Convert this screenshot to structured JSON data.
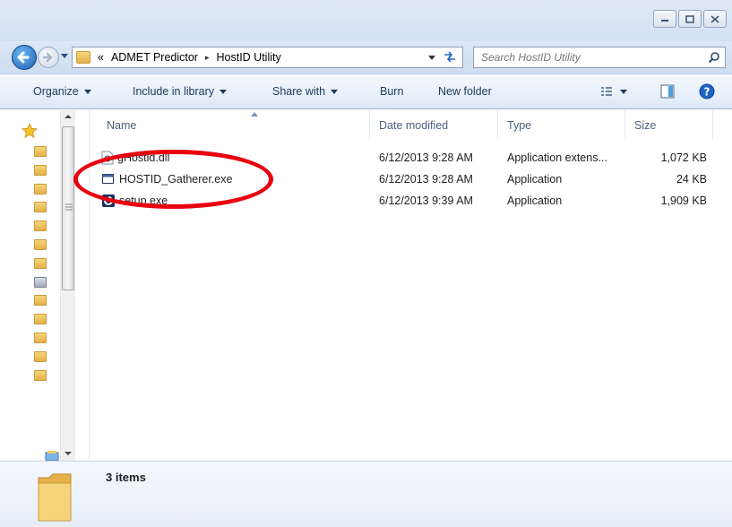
{
  "window": {
    "controls": [
      "minimize",
      "maximize",
      "close"
    ]
  },
  "address": {
    "overflow_glyph": "«",
    "crumbs": [
      "ADMET Predictor",
      "HostID Utility"
    ],
    "separator": "▸"
  },
  "search": {
    "placeholder": "Search HostID Utility"
  },
  "toolbar": {
    "organize": "Organize",
    "include": "Include in library",
    "share": "Share with",
    "burn": "Burn",
    "new_folder": "New folder"
  },
  "columns": {
    "name": "Name",
    "date": "Date modified",
    "type": "Type",
    "size": "Size"
  },
  "files": [
    {
      "name": "gHostid.dll",
      "date": "6/12/2013 9:28 AM",
      "type": "Application extens...",
      "size": "1,072 KB",
      "icon": "dll-icon"
    },
    {
      "name": "HOSTID_Gatherer.exe",
      "date": "6/12/2013 9:28 AM",
      "type": "Application",
      "size": "24 KB",
      "icon": "exe-window-icon"
    },
    {
      "name": "setup.exe",
      "date": "6/12/2013 9:39 AM",
      "type": "Application",
      "size": "1,909 KB",
      "icon": "setup-icon"
    }
  ],
  "status": {
    "count": "3 items"
  },
  "colors": {
    "annotation": "#e8000f",
    "toolbar_text": "#1e395b"
  }
}
